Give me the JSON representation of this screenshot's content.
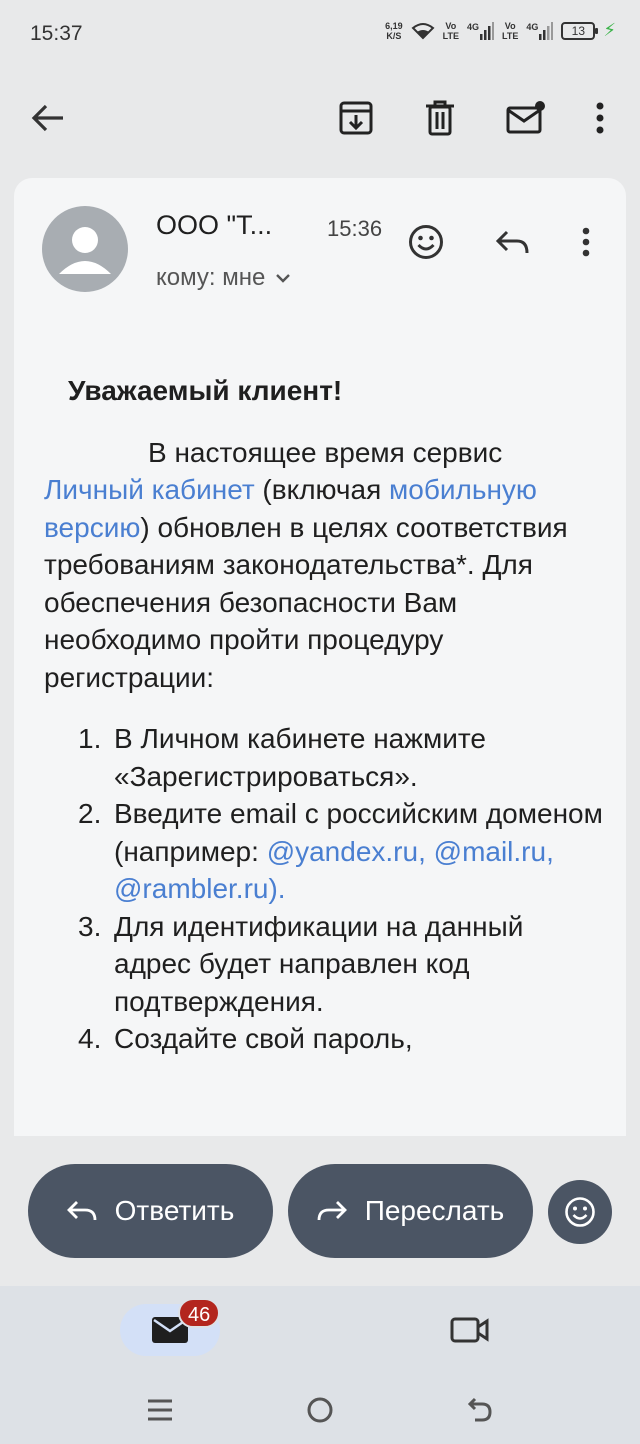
{
  "status": {
    "time": "15:37",
    "speed_value": "6,19",
    "speed_unit": "K/S",
    "sim1": "Vo\nLTE",
    "sim2": "Vo\nLTE",
    "net1": "4G",
    "net2": "4G",
    "battery": "13"
  },
  "toolbar": {
    "icons": [
      "back-arrow-icon",
      "archive-icon",
      "delete-icon",
      "mark-unread-icon",
      "more-vert-icon"
    ]
  },
  "email": {
    "sender": "ООО \"Т...",
    "time": "15:36",
    "recipient": "кому: мне",
    "greeting": "Уважаемый клиент!",
    "para_1": "В настоящее время сервис ",
    "link_1": "Личный кабинет",
    "para_2": " (включая ",
    "link_2": "мобильную версию",
    "para_3": ") обновлен в целях соответствия требованиям законодательства*. Для обеспечения безопасности Вам необходимо пройти процедуру регистрации:",
    "steps": [
      {
        "num": "1.",
        "text": "В Личном кабинете нажмите «Зарегистрироваться»."
      },
      {
        "num": "2.",
        "text_a": "Введите email с российским доменом (например: ",
        "link_a": "@yandex.ru,",
        "text_b": " ",
        "link_b": "@mail.ru,",
        "text_c": " ",
        "link_c": "@rambler.ru)."
      },
      {
        "num": "3.",
        "text": "Для идентификации на данный адрес будет направлен код подтверждения."
      },
      {
        "num": "4.",
        "text": "Создайте свой пароль,"
      }
    ]
  },
  "actions": {
    "reply_label": "Ответить",
    "forward_label": "Переслать"
  },
  "bottom_nav": {
    "mail_badge": "46"
  },
  "colors": {
    "link": "#4a7fd1",
    "button": "#4b5564",
    "badge": "#b3261e"
  }
}
